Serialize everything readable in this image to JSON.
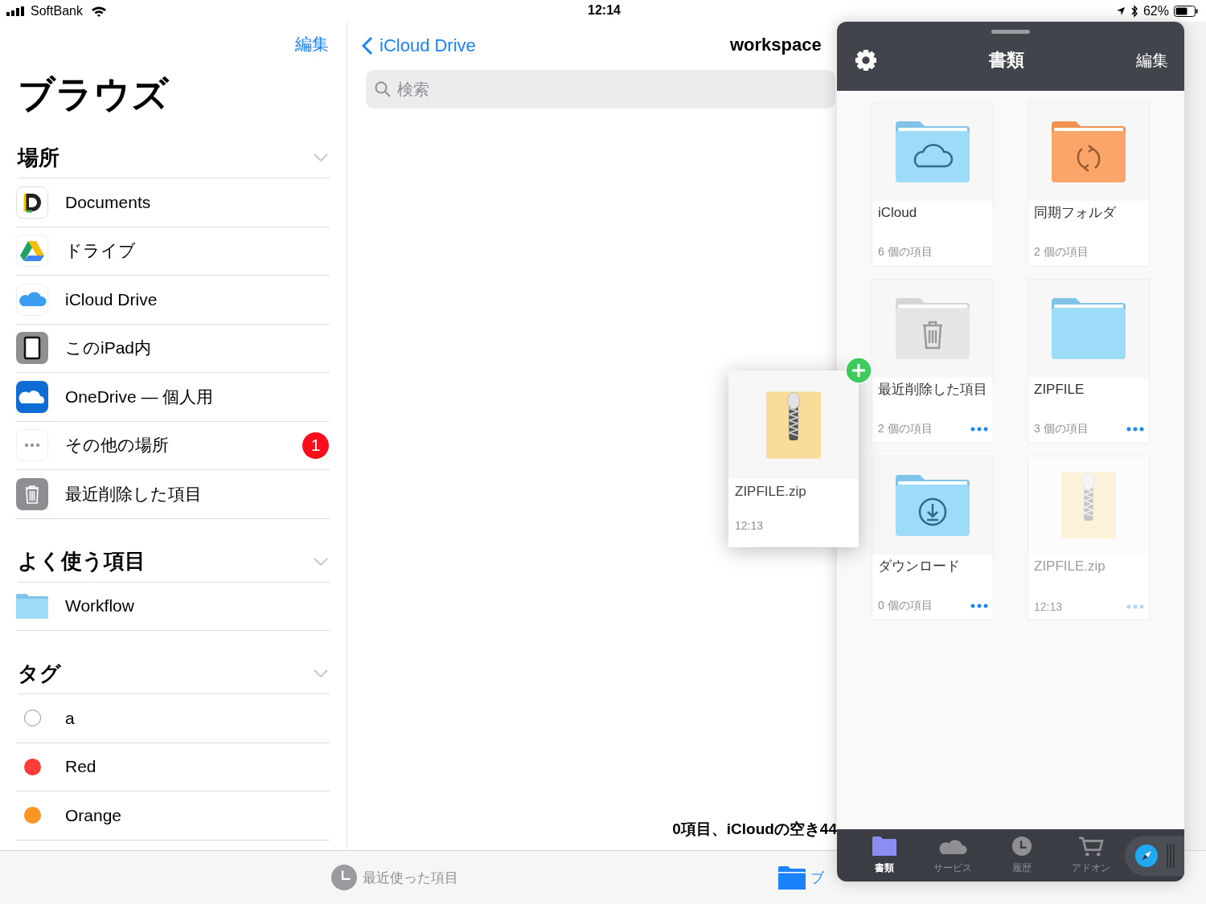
{
  "status_bar": {
    "carrier": "SoftBank",
    "time": "12:14",
    "battery": "62%"
  },
  "sidebar": {
    "edit": "編集",
    "title": "ブラウズ",
    "sections": [
      {
        "title": "場所",
        "expanded": true,
        "items": [
          {
            "kind": "documents",
            "label": "Documents"
          },
          {
            "kind": "drive",
            "label": "ドライブ"
          },
          {
            "kind": "icloud",
            "label": "iCloud Drive"
          },
          {
            "kind": "ipad",
            "label": "このiPad内"
          },
          {
            "kind": "onedrive",
            "label": "OneDrive — 個人用"
          },
          {
            "kind": "more",
            "label": "その他の場所",
            "badge": "1"
          },
          {
            "kind": "trash",
            "label": "最近削除した項目"
          }
        ]
      },
      {
        "title": "よく使う項目",
        "expanded": true,
        "items": [
          {
            "kind": "folder",
            "label": "Workflow"
          }
        ]
      },
      {
        "title": "タグ",
        "expanded": true,
        "items": [
          {
            "kind": "tag",
            "label": "a"
          },
          {
            "kind": "tag",
            "label": "Red",
            "color": "#fc3d39"
          },
          {
            "kind": "tag",
            "label": "Orange",
            "color": "#fd9426"
          }
        ]
      }
    ]
  },
  "browser": {
    "back": "iCloud Drive",
    "title": "workspace",
    "search_placeholder": "検索",
    "footer": "0項目、iCloudの空き44"
  },
  "bottom_tabs": [
    {
      "kind": "clock",
      "label": "最近使った項目",
      "selected": false
    },
    {
      "kind": "folder",
      "label": "ブ",
      "selected": true
    }
  ],
  "panel": {
    "title": "書類",
    "edit": "編集",
    "cards": [
      {
        "kind": "cloud",
        "name": "iCloud",
        "detail": "6 個の項目",
        "menu": false,
        "dimmed": false
      },
      {
        "kind": "sync",
        "name": "同期フォルダ",
        "detail": "2 個の項目",
        "menu": false,
        "dimmed": false
      },
      {
        "kind": "trash",
        "name": "最近削除した項目",
        "detail": "2 個の項目",
        "menu": true,
        "dimmed": false
      },
      {
        "kind": "plain",
        "name": "ZIPFILE",
        "detail": "3 個の項目",
        "menu": true,
        "dimmed": false
      },
      {
        "kind": "download",
        "name": "ダウンロード",
        "detail": "0 個の項目",
        "menu": true,
        "dimmed": false
      },
      {
        "kind": "zip",
        "name": "ZIPFILE.zip",
        "detail": "12:13",
        "menu": true,
        "dimmed": true
      }
    ],
    "tabs": [
      {
        "kind": "folder",
        "label": "書類",
        "selected": true
      },
      {
        "kind": "cloud",
        "label": "サービス",
        "selected": false
      },
      {
        "kind": "clock",
        "label": "履歴",
        "selected": false
      },
      {
        "kind": "cart",
        "label": "アドオン",
        "selected": false
      }
    ]
  },
  "dragged": {
    "kind": "zip",
    "name": "ZIPFILE.zip",
    "detail": "12:13"
  }
}
